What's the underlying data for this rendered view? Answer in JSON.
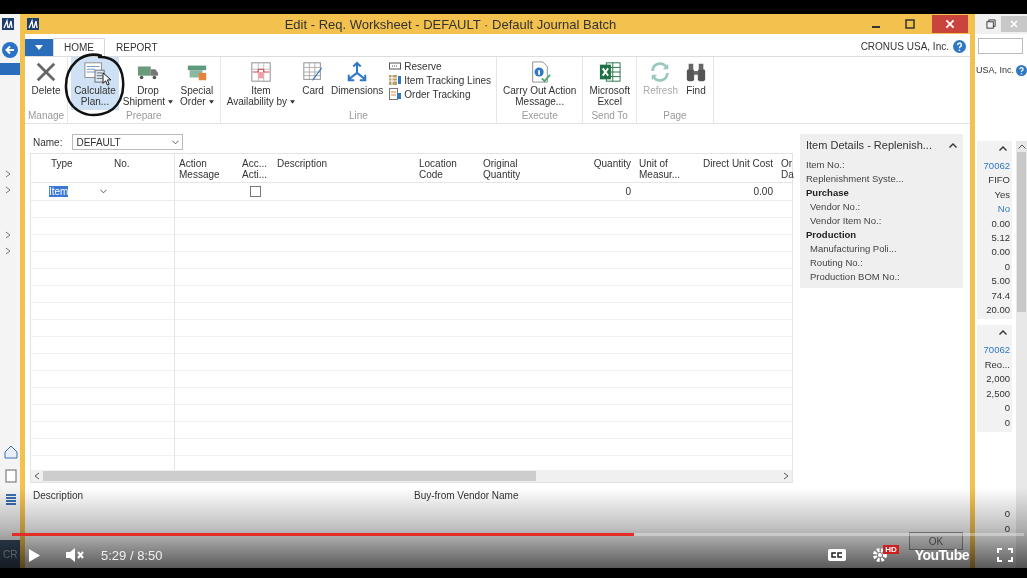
{
  "window": {
    "title": "Edit - Req. Worksheet - DEFAULT · Default Journal Batch",
    "company": "CRONUS USA, Inc."
  },
  "tabs": [
    {
      "label": "HOME",
      "selected": true
    },
    {
      "label": "REPORT",
      "selected": false
    }
  ],
  "ribbon": {
    "groups": [
      {
        "label": "Manage",
        "items": [
          {
            "kind": "large",
            "label": "Delete",
            "selected": false,
            "disabled": false,
            "menu": false
          }
        ]
      },
      {
        "label": "Prepare",
        "items": [
          {
            "kind": "large",
            "label": "Calculate\nPlan...",
            "selected": true,
            "disabled": false,
            "menu": false
          },
          {
            "kind": "large",
            "label": "Drop\nShipment",
            "selected": false,
            "disabled": false,
            "menu": true
          },
          {
            "kind": "large",
            "label": "Special\nOrder",
            "selected": false,
            "disabled": false,
            "menu": true
          }
        ]
      },
      {
        "label": "Line",
        "items": [
          {
            "kind": "large",
            "label": "Item\nAvailability by",
            "selected": false,
            "disabled": false,
            "menu": true
          },
          {
            "kind": "large",
            "label": "Card",
            "selected": false,
            "disabled": false,
            "menu": false
          },
          {
            "kind": "large",
            "label": "Dimensions",
            "selected": false,
            "disabled": false,
            "menu": false
          },
          {
            "kind": "small",
            "label": "Reserve"
          },
          {
            "kind": "small",
            "label": "Item Tracking Lines"
          },
          {
            "kind": "small",
            "label": "Order Tracking"
          }
        ]
      },
      {
        "label": "Execute",
        "items": [
          {
            "kind": "large",
            "label": "Carry Out Action\nMessage...",
            "selected": false,
            "disabled": false,
            "menu": false
          }
        ]
      },
      {
        "label": "Send To",
        "items": [
          {
            "kind": "large",
            "label": "Microsoft\nExcel",
            "selected": false,
            "disabled": false,
            "menu": false
          }
        ]
      },
      {
        "label": "Page",
        "items": [
          {
            "kind": "large",
            "label": "Refresh",
            "selected": false,
            "disabled": true,
            "menu": false
          },
          {
            "kind": "large",
            "label": "Find",
            "selected": false,
            "disabled": false,
            "menu": false
          }
        ]
      }
    ]
  },
  "name_field": {
    "label": "Name:",
    "value": "DEFAULT"
  },
  "grid": {
    "columns": [
      {
        "label": "Type"
      },
      {
        "label": "No."
      },
      {
        "label": "Action\nMessage"
      },
      {
        "label": "Acc...\nActi..."
      },
      {
        "label": "Description"
      },
      {
        "label": "Location\nCode"
      },
      {
        "label": "Original Quantity"
      },
      {
        "label": "Quantity"
      },
      {
        "label": "Unit of\nMeasur..."
      },
      {
        "label": "Direct Unit Cost"
      },
      {
        "label": "Or\nDa"
      }
    ],
    "rows": [
      {
        "type": "Item",
        "type_selected": true,
        "accept_checked": false,
        "quantity": "0",
        "direct_unit_cost": "0.00"
      }
    ]
  },
  "factbox": {
    "title": "Item Details - Replenish...",
    "rows": [
      {
        "kind": "field",
        "label": "Item No.:"
      },
      {
        "kind": "field",
        "label": "Replenishment Syste..."
      },
      {
        "kind": "group",
        "label": "Purchase"
      },
      {
        "kind": "subfield",
        "label": "Vendor No.:"
      },
      {
        "kind": "subfield",
        "label": "Vendor Item No.:"
      },
      {
        "kind": "group",
        "label": "Production"
      },
      {
        "kind": "subfield",
        "label": "Manufacturing Poli..."
      },
      {
        "kind": "subfield",
        "label": "Routing No.:"
      },
      {
        "kind": "subfield",
        "label": "Production BOM No.:"
      }
    ]
  },
  "footer": {
    "labels": [
      "Description",
      "Buy-from Vendor Name"
    ],
    "ok_button": "OK"
  },
  "background_left": {
    "text": "CR"
  },
  "background_right": {
    "company": "USA, Inc.",
    "panels": [
      {
        "collapsible": true,
        "values": [
          {
            "text": "70062",
            "link": true
          },
          {
            "text": "FIFO",
            "link": false
          },
          {
            "text": "Yes",
            "link": false
          },
          {
            "text": "No",
            "link": true
          },
          {
            "text": "0.00",
            "link": false
          },
          {
            "text": "5.12",
            "link": false
          },
          {
            "text": "0.00",
            "link": false
          },
          {
            "text": "0",
            "link": false
          },
          {
            "text": "5.00",
            "link": false
          },
          {
            "text": "74.4",
            "link": false
          },
          {
            "text": "20.00",
            "link": false
          }
        ]
      },
      {
        "collapsible": true,
        "values": [
          {
            "text": "70062",
            "link": true
          },
          {
            "text": "Reo...",
            "link": false
          },
          {
            "text": "2,000",
            "link": false
          },
          {
            "text": "2,500",
            "link": false
          },
          {
            "text": "0",
            "link": false
          },
          {
            "text": "0",
            "link": false
          }
        ]
      },
      {
        "collapsible": false,
        "values": [
          {
            "text": "0",
            "link": false
          },
          {
            "text": "0",
            "link": false
          }
        ]
      }
    ]
  },
  "video": {
    "progress": {
      "level": 0.615
    },
    "time": "5:29 / 8:50",
    "muted": true,
    "hd_badge": "HD",
    "logo": "YouTube"
  }
}
